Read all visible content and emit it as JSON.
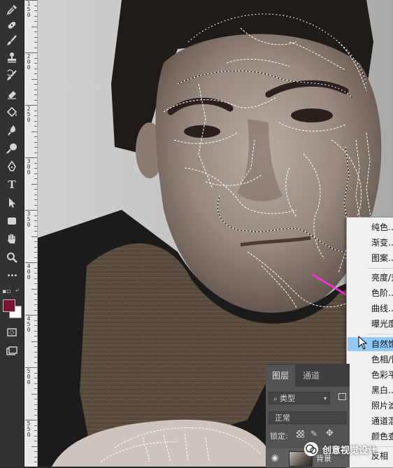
{
  "toolbar": {
    "tools": [
      {
        "icon": "eyedropper-icon"
      },
      {
        "icon": "healing-brush-icon"
      },
      {
        "icon": "brush-icon"
      },
      {
        "icon": "clone-stamp-icon"
      },
      {
        "icon": "history-brush-icon"
      },
      {
        "icon": "eraser-icon"
      },
      {
        "icon": "paint-bucket-icon"
      },
      {
        "icon": "blur-icon"
      },
      {
        "icon": "dodge-icon"
      },
      {
        "icon": "pen-icon"
      },
      {
        "icon": "type-icon",
        "glyph": "T"
      },
      {
        "icon": "path-selection-icon"
      },
      {
        "icon": "rectangle-icon"
      },
      {
        "icon": "hand-icon"
      },
      {
        "icon": "zoom-icon"
      },
      {
        "icon": "more-tools-icon",
        "glyph": "•••"
      }
    ],
    "foreground_color": "#7a1230",
    "background_color": "#ffffff"
  },
  "ruler": {
    "labels": [
      "1\n5\n0",
      "2\n0\n0",
      "2\n5\n0",
      "3\n0\n0",
      "3\n5\n0",
      "4\n0\n0",
      "4\n5\n0",
      "5\n0\n0",
      "5\n5\n0"
    ]
  },
  "context_menu": {
    "items": [
      "纯色...",
      "渐变...",
      "图案...",
      "亮度/对比度...",
      "色阶...",
      "曲线...",
      "曝光度...",
      "自然饱和度...",
      "色相/饱和度...",
      "色彩平衡...",
      "黑白...",
      "照片滤镜...",
      "通道混合器...",
      "颜色查找...",
      "反相"
    ],
    "highlighted_index": 7,
    "highlight_color": "#91c9f7"
  },
  "annotation": {
    "arrow_color": "#ff2be0"
  },
  "layers_panel": {
    "tabs": [
      "图层",
      "通道"
    ],
    "filter_label": "类型",
    "blend_mode": "正常",
    "lock_label": "锁定:",
    "layer_name": "背景"
  },
  "watermark": {
    "text": "创意视觉设计"
  }
}
